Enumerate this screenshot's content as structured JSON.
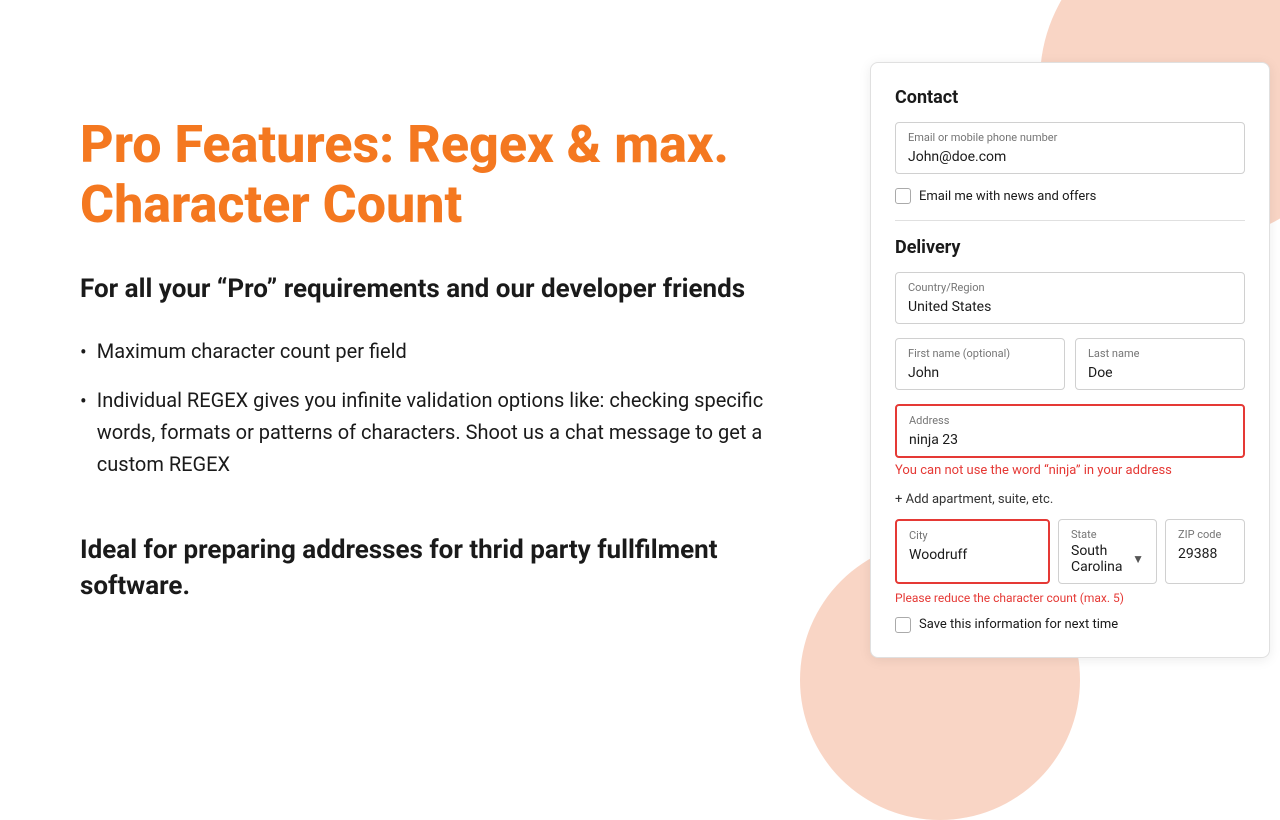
{
  "decorations": {
    "top_right": "peach circle",
    "bottom_right": "peach circle"
  },
  "left": {
    "title": "Pro Features: Regex & max. Character Count",
    "subtitle": "For all your “Pro” requirements and our developer friends",
    "bullets": [
      "Maximum character count per field",
      "Individual REGEX gives you infinite validation options like: checking specific words, formats or patterns of characters. Shoot us a chat message to get a custom REGEX"
    ],
    "bottom_text": "Ideal for preparing addresses for thrid party fullfilment  software."
  },
  "form": {
    "contact_label": "Contact",
    "email_label": "Email or mobile phone number",
    "email_value": "John@doe.com",
    "email_checkbox_label": "Email me with news and offers",
    "delivery_label": "Delivery",
    "country_label": "Country/Region",
    "country_value": "United States",
    "first_name_label": "First name (optional)",
    "first_name_value": "John",
    "last_name_label": "Last name",
    "last_name_value": "Doe",
    "address_label": "Address",
    "address_value": "ninja 23",
    "address_error": "You can not use the word “ninja” in your address",
    "add_apartment_link": "+ Add apartment, suite, etc.",
    "city_label": "City",
    "city_value": "Woodruff",
    "state_label": "State",
    "state_value": "South Carolina",
    "zip_label": "ZIP code",
    "zip_value": "29388",
    "city_error": "Please reduce the character count (max. 5)",
    "save_label": "Save this information for next time"
  }
}
